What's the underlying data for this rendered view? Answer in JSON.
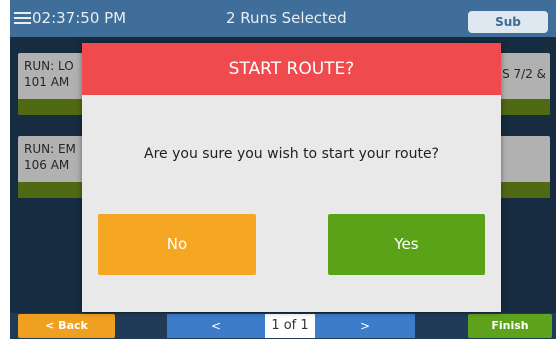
{
  "header": {
    "time": "02:37:50 PM",
    "selection_text": "2 Runs Selected",
    "sub_label": "Sub"
  },
  "runs": [
    {
      "line1": "RUN: LO",
      "line2": "101 AM",
      "right_text": "S  7/2 &"
    },
    {
      "line1": "RUN: EM",
      "line2": "106 AM",
      "right_text": ""
    }
  ],
  "dialog": {
    "title": "START ROUTE?",
    "message": "Are you sure you wish to start your route?",
    "no_label": "No",
    "yes_label": "Yes"
  },
  "footer": {
    "back_label": "< Back",
    "prev_label": "<",
    "page_text": "1 of 1",
    "next_label": ">",
    "finish_label": "Finish"
  },
  "colors": {
    "header_bg": "#3e6e99",
    "dialog_header": "#ef4b4f",
    "no_button": "#f5a623",
    "yes_button": "#5aa319",
    "nav_blue": "#3d7cc9",
    "finish_green": "#5fa31c"
  }
}
